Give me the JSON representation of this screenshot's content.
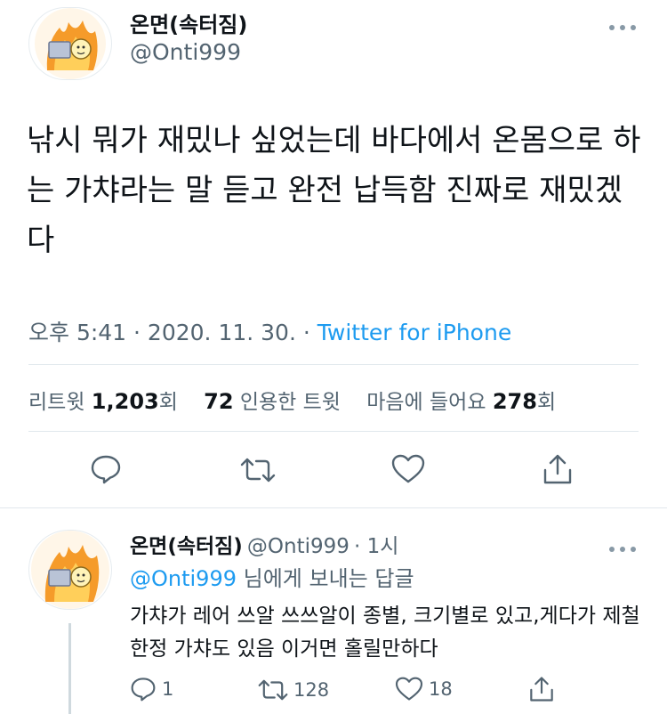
{
  "main_tweet": {
    "display_name": "온면(속터짐)",
    "handle": "@Onti999",
    "text": "낚시 뭐가 재밌나 싶었는데 바다에서 온몸으로 하는 가챠라는 말 듣고 완전 납득함 진짜로 재밌겠다",
    "time": "오후 5:41 · 2020. 11. 30. · ",
    "source": "Twitter for iPhone",
    "stats": {
      "retweet_label": "리트윗 ",
      "retweet_count": "1,203",
      "retweet_suffix": "회",
      "quote_count": "72",
      "quote_label": " 인용한 트윗",
      "like_label": "마음에 들어요 ",
      "like_count": "278",
      "like_suffix": "회"
    }
  },
  "reply": {
    "display_name": "온면(속터짐)",
    "handle": "@Onti999",
    "time": "· 1시",
    "reply_to_mention": "@Onti999",
    "reply_to_suffix": " 님에게 보내는 답글",
    "text": "가챠가 레어 쓰알 쓰쓰알이 종별, 크기별로 있고,게다가 제철 한정 가챠도 있음 이거면 홀릴만하다",
    "reply_count": "1",
    "retweet_count": "128",
    "like_count": "18"
  },
  "icons": {
    "more": "more-dots-icon",
    "reply": "reply-bubble-icon",
    "retweet": "retweet-icon",
    "like": "heart-icon",
    "share": "share-icon"
  },
  "colors": {
    "link": "#1d9bf0",
    "secondary_text": "#536471",
    "divider": "#e1e8ed"
  }
}
